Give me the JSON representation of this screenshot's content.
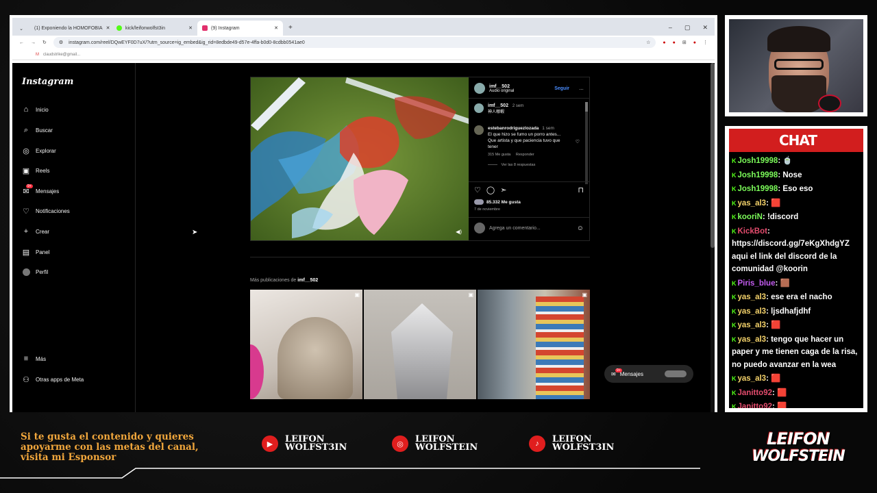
{
  "browser": {
    "tabs": [
      {
        "title": "(1) Exponiendo la HOMOFOBIA",
        "favicon_color": "#ff0000"
      },
      {
        "title": "kick/leifonwolfst3in",
        "favicon_color": "#53fc18"
      },
      {
        "title": "(9) Instagram",
        "favicon_color": "#e1306c"
      }
    ],
    "url": "instagram.com/reel/DQwEYF0D7uX/?utm_source=ig_embed&ig_rid=8edbde49-d57e-4ffa-b0d0-8cdbb0541ae0",
    "bookmark": "claudstrike@gmail..."
  },
  "instagram": {
    "logo": "Instagram",
    "nav": [
      {
        "label": "Inicio",
        "icon": "home-icon"
      },
      {
        "label": "Buscar",
        "icon": "search-icon"
      },
      {
        "label": "Explorar",
        "icon": "compass-icon"
      },
      {
        "label": "Reels",
        "icon": "reels-icon"
      },
      {
        "label": "Mensajes",
        "icon": "messages-icon",
        "badge": "9+"
      },
      {
        "label": "Notificaciones",
        "icon": "heart-icon"
      },
      {
        "label": "Crear",
        "icon": "plus-icon"
      },
      {
        "label": "Panel",
        "icon": "chart-icon"
      },
      {
        "label": "Perfil",
        "icon": "avatar-icon"
      }
    ],
    "nav_bottom": [
      {
        "label": "Más",
        "icon": "menu-icon"
      },
      {
        "label": "Otras apps de Meta",
        "icon": "meta-icon"
      }
    ],
    "post": {
      "user": "imf__502",
      "audio": "Audio original",
      "follow": "Seguir",
      "caption_user": "imf__502",
      "caption_time": "2 sem",
      "caption_text": "神人哪蝦",
      "comment_user": "estebanrodriguezlozada",
      "comment_time": "1 sem",
      "comment_text": "El que hizo se fumo un porro antes... Que artista y que paciencia tuvo que tener",
      "comment_likes": "315 Me gusta",
      "comment_reply": "Responder",
      "view_replies": "Ver las 8 respuestas",
      "likes": "85.332 Me gusta",
      "date": "7 de noviembre",
      "add_comment": "Agrega un comentario..."
    },
    "more_label": "Más publicaciones de",
    "more_user": "imf__502",
    "messages_pill": "Mensajes",
    "messages_badge": "9+"
  },
  "chat": {
    "title": "CHAT",
    "messages": [
      {
        "user": "Josh19998",
        "color": "#7cfc5a",
        "text": ": 🍵"
      },
      {
        "user": "Josh19998",
        "color": "#7cfc5a",
        "text": ": Nose"
      },
      {
        "user": "Josh19998",
        "color": "#7cfc5a",
        "text": ": Eso eso"
      },
      {
        "user": "yas_al3",
        "color": "#f5d36b",
        "text": ": 🟥"
      },
      {
        "user": "kooriN",
        "color": "#7cfc5a",
        "text": ": !discord"
      },
      {
        "user": "KickBot",
        "color": "#e34c6d",
        "text": ": https://discord.gg/7eKgXhdgYZ aqui el link del discord de la comunidad @koorin"
      },
      {
        "user": "Piris_blue",
        "color": "#c45cf0",
        "text": ": 🟫"
      },
      {
        "user": "yas_al3",
        "color": "#f5d36b",
        "text": ": ese era el nacho"
      },
      {
        "user": "yas_al3",
        "color": "#f5d36b",
        "text": ": ljsdhafjdhf"
      },
      {
        "user": "yas_al3",
        "color": "#f5d36b",
        "text": ": 🟥"
      },
      {
        "user": "yas_al3",
        "color": "#f5d36b",
        "text": ": tengo que hacer un paper y me tienen caga de la risa, no puedo avanzar en la wea"
      },
      {
        "user": "yas_al3",
        "color": "#f5d36b",
        "text": ": 🟥"
      },
      {
        "user": "Janitto92",
        "color": "#e34c6d",
        "text": ": 🟥"
      },
      {
        "user": "Janitto92",
        "color": "#e34c6d",
        "text": ": 🟥"
      }
    ]
  },
  "footer": {
    "sponsor": "Si te gusta el contenido y quieres apoyarme con las metas del canal, visita mi Esponsor",
    "socials": [
      {
        "icon": "youtube-icon",
        "line1": "LEIFON",
        "line2": "WOLFST3IN"
      },
      {
        "icon": "instagram-icon",
        "line1": "LEIFON",
        "line2": "WOLFSTEIN"
      },
      {
        "icon": "tiktok-icon",
        "line1": "LEIFON",
        "line2": "WOLFST3IN"
      }
    ],
    "brand_line1": "LEIFON",
    "brand_line2": "WOLFSTEIN"
  }
}
